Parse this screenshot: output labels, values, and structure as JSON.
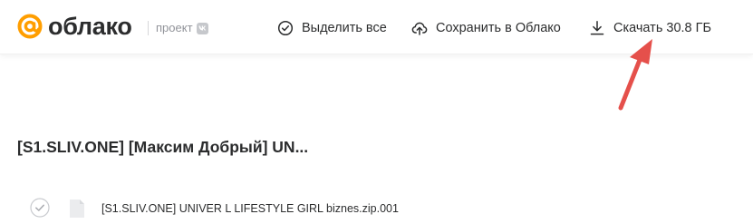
{
  "brand": {
    "name": "облако",
    "accent_color": "#ff9e00"
  },
  "project_label": "проект",
  "project_badge_icon": "vk-icon",
  "toolbar": {
    "select_all": "Выделить все",
    "save_to_cloud": "Сохранить в Облако",
    "download": "Скачать 30.8 ГБ"
  },
  "folder": {
    "title": "[S1.SLIV.ONE] [Максим Добрый] UN..."
  },
  "files": [
    {
      "name": "[S1.SLIV.ONE] UNIVER L LIFESTYLE GIRL biznes.zip.001",
      "selected": false
    }
  ],
  "annotation": {
    "arrow_color": "#e5504b"
  }
}
